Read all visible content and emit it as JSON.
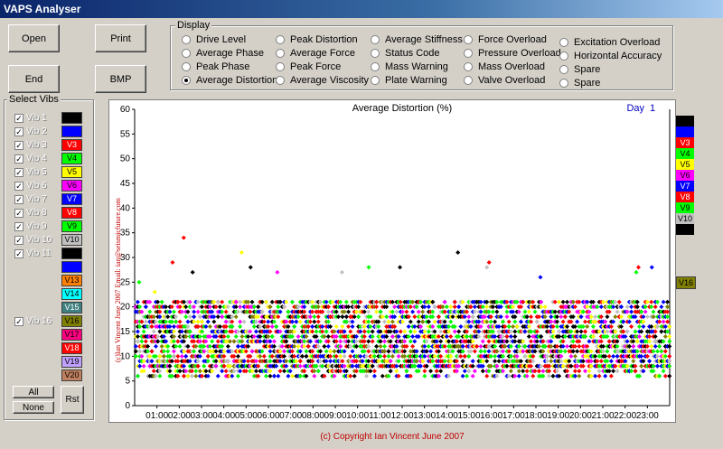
{
  "window": {
    "title": "VAPS Analyser"
  },
  "buttons": {
    "open": "Open",
    "print": "Print",
    "end": "End",
    "bmp": "BMP",
    "all": "All",
    "none": "None",
    "rst": "Rst"
  },
  "display": {
    "label": "Display",
    "options": [
      {
        "label": "Drive Level",
        "selected": false
      },
      {
        "label": "Average Phase",
        "selected": false
      },
      {
        "label": "Peak Phase",
        "selected": false
      },
      {
        "label": "Average Distortion",
        "selected": true
      },
      {
        "label": "Peak Distortion",
        "selected": false
      },
      {
        "label": "Average Force",
        "selected": false
      },
      {
        "label": "Peak Force",
        "selected": false
      },
      {
        "label": "Average Viscosity",
        "selected": false
      },
      {
        "label": "Average Stiffness",
        "selected": false
      },
      {
        "label": "Status Code",
        "selected": false
      },
      {
        "label": "Mass Warning",
        "selected": false
      },
      {
        "label": "Plate Warning",
        "selected": false
      },
      {
        "label": "Force Overload",
        "selected": false
      },
      {
        "label": "Pressure Overload",
        "selected": false
      },
      {
        "label": "Mass Overload",
        "selected": false
      },
      {
        "label": "Valve Overload",
        "selected": false
      },
      {
        "label": "Excitation Overload",
        "selected": false
      },
      {
        "label": "Horizontal Accuracy",
        "selected": false
      },
      {
        "label": "Spare",
        "selected": false
      },
      {
        "label": "Spare",
        "selected": false
      }
    ]
  },
  "select_vibs": {
    "label": "Select Vibs",
    "items": [
      {
        "label": "Vib 1",
        "checked": true,
        "swatch": "",
        "color": "#000000"
      },
      {
        "label": "Vib 2",
        "checked": true,
        "swatch": "",
        "color": "#0000ff"
      },
      {
        "label": "Vib 3",
        "checked": true,
        "swatch": "V3",
        "color": "#ff0000"
      },
      {
        "label": "Vib 4",
        "checked": true,
        "swatch": "V4",
        "color": "#00ff00"
      },
      {
        "label": "Vib 5",
        "checked": true,
        "swatch": "V5",
        "color": "#ffff00"
      },
      {
        "label": "Vib 6",
        "checked": true,
        "swatch": "V6",
        "color": "#ff00ff"
      },
      {
        "label": "Vib 7",
        "checked": true,
        "swatch": "V7",
        "color": "#0000ff"
      },
      {
        "label": "Vib 8",
        "checked": true,
        "swatch": "V8",
        "color": "#ff0000"
      },
      {
        "label": "Vib 9",
        "checked": true,
        "swatch": "V9",
        "color": "#00ff00"
      },
      {
        "label": "Vib 10",
        "checked": true,
        "swatch": "V10",
        "color": "#c0c0c0"
      },
      {
        "label": "Vib 11",
        "checked": true,
        "swatch": "",
        "color": "#000000"
      },
      {
        "label": "",
        "checked": false,
        "swatch": "",
        "color": "#0000ff"
      },
      {
        "label": "",
        "checked": false,
        "swatch": "V13",
        "color": "#ff8000"
      },
      {
        "label": "",
        "checked": false,
        "swatch": "V14",
        "color": "#00ffff"
      },
      {
        "label": "",
        "checked": false,
        "swatch": "V15",
        "color": "#408080"
      },
      {
        "label": "Vib 16",
        "checked": true,
        "swatch": "V16",
        "color": "#808000"
      },
      {
        "label": "",
        "checked": false,
        "swatch": "V17",
        "color": "#ff0080"
      },
      {
        "label": "",
        "checked": false,
        "swatch": "V18",
        "color": "#ff0000"
      },
      {
        "label": "",
        "checked": false,
        "swatch": "V19",
        "color": "#c0a0ff"
      },
      {
        "label": "",
        "checked": false,
        "swatch": "V20",
        "color": "#c08060"
      }
    ]
  },
  "chart_data": {
    "type": "scatter",
    "title": "Average Distortion (%)",
    "day_label": "Day",
    "day_value": "1",
    "ylim": [
      0,
      60
    ],
    "yticks": [
      0,
      5,
      10,
      15,
      20,
      25,
      30,
      35,
      40,
      45,
      50,
      55,
      60
    ],
    "xticks": [
      "01:00",
      "02:00",
      "03:00",
      "04:00",
      "05:00",
      "06:00",
      "07:00",
      "08:00",
      "09:00",
      "10:00",
      "11:00",
      "12:00",
      "13:00",
      "14:00",
      "15:00",
      "16:00",
      "17:00",
      "18:00",
      "19:00",
      "20:00",
      "21:00",
      "22:00",
      "23:00"
    ],
    "xlim_hours": [
      0,
      24
    ],
    "grid": false,
    "watermark": "(c)Ian Vincent June 2007 Email: ian@seismicfuture.com",
    "series_colors": [
      "#000000",
      "#0000ff",
      "#ff0000",
      "#00ff00",
      "#ffff00",
      "#ff00ff",
      "#0000ff",
      "#ff0000",
      "#00ff00",
      "#c0c0c0",
      "#000000",
      "#808000"
    ],
    "typical_range": [
      6,
      22
    ],
    "outliers": [
      {
        "x": 0.2,
        "y": 25,
        "color": "#00ff00"
      },
      {
        "x": 0.9,
        "y": 23,
        "color": "#ffff00"
      },
      {
        "x": 1.7,
        "y": 29,
        "color": "#ff0000"
      },
      {
        "x": 2.2,
        "y": 34,
        "color": "#ff0000"
      },
      {
        "x": 2.6,
        "y": 27,
        "color": "#000000"
      },
      {
        "x": 4.8,
        "y": 31,
        "color": "#ffff00"
      },
      {
        "x": 5.2,
        "y": 28,
        "color": "#000000"
      },
      {
        "x": 6.4,
        "y": 27,
        "color": "#ff00ff"
      },
      {
        "x": 9.3,
        "y": 27,
        "color": "#c0c0c0"
      },
      {
        "x": 10.5,
        "y": 28,
        "color": "#00ff00"
      },
      {
        "x": 11.9,
        "y": 28,
        "color": "#000000"
      },
      {
        "x": 14.5,
        "y": 31,
        "color": "#000000"
      },
      {
        "x": 15.8,
        "y": 28,
        "color": "#c0c0c0"
      },
      {
        "x": 15.9,
        "y": 29,
        "color": "#ff0000"
      },
      {
        "x": 18.2,
        "y": 26,
        "color": "#0000ff"
      },
      {
        "x": 22.5,
        "y": 27,
        "color": "#00ff00"
      },
      {
        "x": 22.6,
        "y": 28,
        "color": "#ff0000"
      },
      {
        "x": 23.2,
        "y": 28,
        "color": "#0000ff"
      }
    ]
  },
  "legend": [
    {
      "label": "",
      "color": "#000000"
    },
    {
      "label": "",
      "color": "#0000ff"
    },
    {
      "label": "V3",
      "color": "#ff0000"
    },
    {
      "label": "V4",
      "color": "#00ff00"
    },
    {
      "label": "V5",
      "color": "#ffff00"
    },
    {
      "label": "V6",
      "color": "#ff00ff"
    },
    {
      "label": "V7",
      "color": "#0000ff"
    },
    {
      "label": "V8",
      "color": "#ff0000"
    },
    {
      "label": "V9",
      "color": "#00ff00"
    },
    {
      "label": "V10",
      "color": "#c0c0c0"
    },
    {
      "label": "",
      "color": "#000000"
    },
    {
      "label": "V16",
      "color": "#808000"
    }
  ],
  "copyright": "(c) Copyright Ian Vincent June 2007"
}
